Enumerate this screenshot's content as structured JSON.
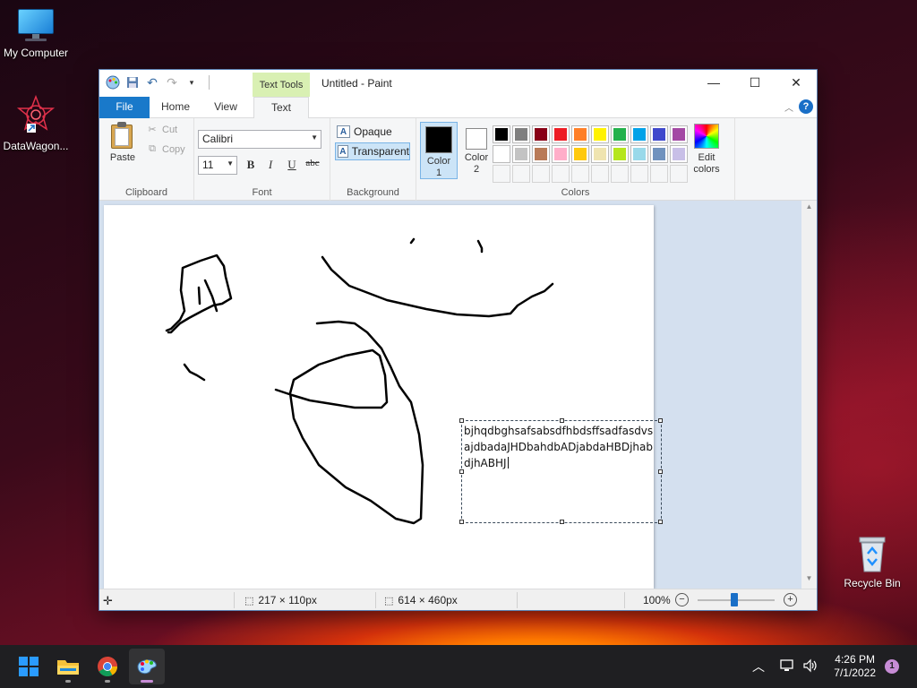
{
  "desktop": {
    "icons": [
      {
        "label": "My Computer"
      },
      {
        "label": "DataWagon..."
      },
      {
        "label": "Recycle Bin"
      }
    ]
  },
  "window": {
    "title": "Untitled - Paint",
    "context_tab_header": "Text Tools",
    "tabs": [
      "File",
      "Home",
      "View",
      "Text"
    ],
    "active_tab": "Text"
  },
  "ribbon": {
    "clipboard": {
      "paste": "Paste",
      "cut": "Cut",
      "copy": "Copy",
      "label": "Clipboard"
    },
    "font": {
      "family": "Calibri",
      "size": "11",
      "bold": "B",
      "italic": "I",
      "underline": "U",
      "strikethrough": "abc",
      "label": "Font"
    },
    "background": {
      "opaque": "Opaque",
      "transparent": "Transparent",
      "selected": "Transparent",
      "label": "Background"
    },
    "colors": {
      "color1_label_top": "Color",
      "color1_label_bottom": "1",
      "color2_label_top": "Color",
      "color2_label_bottom": "2",
      "color1": "#000000",
      "color2": "#ffffff",
      "edit_top": "Edit",
      "edit_bottom": "colors",
      "label": "Colors",
      "palette_row1": [
        "#000000",
        "#7f7f7f",
        "#880015",
        "#ed1c24",
        "#ff7f27",
        "#fff200",
        "#22b14c",
        "#00a2e8",
        "#3f48cc",
        "#a349a4"
      ],
      "palette_row2": [
        "#ffffff",
        "#c3c3c3",
        "#b97a57",
        "#ffaec9",
        "#ffc90e",
        "#efe4b0",
        "#b5e61d",
        "#99d9ea",
        "#7092be",
        "#c8bfe7"
      ]
    }
  },
  "canvas": {
    "text_lines": [
      "bjhqdbghsafsabsdfhbdsffsadfasdvs",
      "ajdbadaJHDbahdbADjabdaHBDjhab",
      "djhABHJ"
    ]
  },
  "status": {
    "selection_size": "217 × 110px",
    "canvas_size": "614 × 460px",
    "zoom": "100%"
  },
  "taskbar": {
    "time": "4:26 PM",
    "date": "7/1/2022",
    "notification_count": "1"
  }
}
